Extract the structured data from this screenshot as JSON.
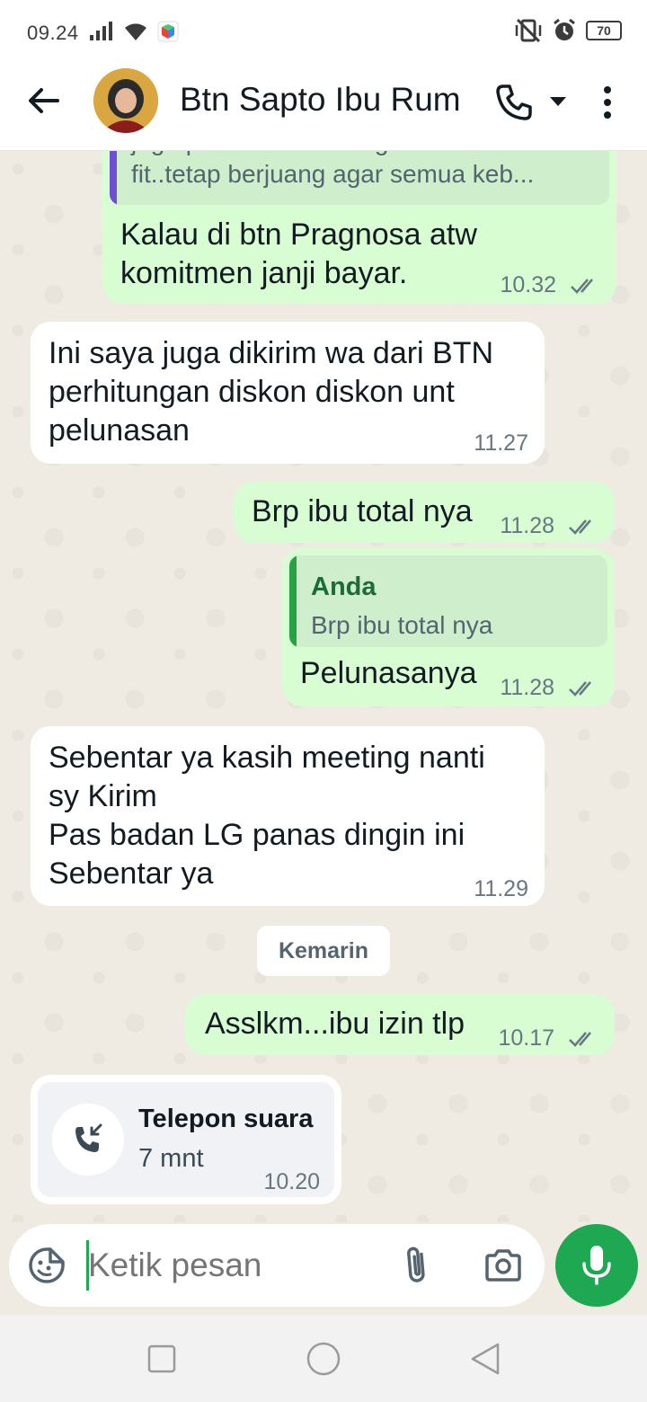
{
  "status_bar": {
    "time": "09.24",
    "battery": "70"
  },
  "header": {
    "contact_name": "Btn Sapto Ibu Rum"
  },
  "messages": [
    {
      "direction": "outgoing",
      "quote_lines": [
        "juga pak walan sedang TDK",
        "fit..tetap berjuang  agar semua keb..."
      ],
      "lines": [
        "Kalau di btn Pragnosa atw",
        "komitmen janji bayar."
      ],
      "time": "10.32",
      "status": "read"
    },
    {
      "direction": "incoming",
      "lines": [
        "Ini saya juga dikirim wa dari BTN",
        "perhitungan diskon diskon unt",
        "pelunasan"
      ],
      "time": "11.27"
    },
    {
      "direction": "outgoing",
      "lines": [
        "Brp ibu total nya"
      ],
      "time": "11.28",
      "status": "read"
    },
    {
      "direction": "outgoing",
      "quote_author": "Anda",
      "quote_lines": [
        "Brp ibu total nya"
      ],
      "lines": [
        "Pelunasanya"
      ],
      "time": "11.28",
      "status": "read"
    },
    {
      "direction": "incoming",
      "lines": [
        "Sebentar ya kasih meeting nanti",
        "sy Kirim",
        "Pas badan LG panas dingin ini",
        "Sebentar ya"
      ],
      "time": "11.29"
    }
  ],
  "date_separator": "Kemarin",
  "messages_after": [
    {
      "direction": "outgoing",
      "lines": [
        "Asslkm...ibu izin tlp"
      ],
      "time": "10.17",
      "status": "read"
    }
  ],
  "call_card": {
    "title": "Telepon suara",
    "duration": "7 mnt",
    "time": "10.20"
  },
  "input": {
    "placeholder": "Ketik pesan"
  },
  "colors": {
    "outgoing_bubble": "#d9fdd3",
    "incoming_bubble": "#ffffff",
    "accent": "#1da851",
    "read_ticks": "#667781",
    "quote_bar_contact": "#6f4ed4",
    "quote_bar_self": "#25a244"
  }
}
